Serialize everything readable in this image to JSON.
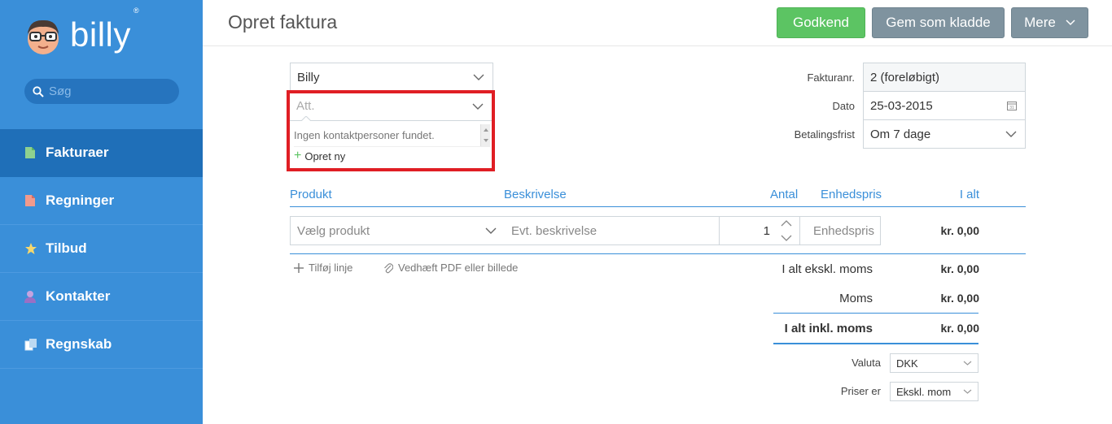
{
  "app": {
    "logo_text": "billy",
    "logo_reg": "®"
  },
  "search": {
    "placeholder": "Søg"
  },
  "nav": {
    "items": [
      {
        "label": "Fakturaer",
        "icon": "invoice-icon",
        "active": true
      },
      {
        "label": "Regninger",
        "icon": "bill-icon"
      },
      {
        "label": "Tilbud",
        "icon": "star-icon"
      },
      {
        "label": "Kontakter",
        "icon": "person-icon"
      },
      {
        "label": "Regnskab",
        "icon": "ledger-icon"
      }
    ]
  },
  "header": {
    "title": "Opret faktura",
    "approve_label": "Godkend",
    "draft_label": "Gem som kladde",
    "more_label": "Mere"
  },
  "form": {
    "customer_value": "Billy",
    "att_placeholder": "Att.",
    "att_dropdown": {
      "empty_message": "Ingen kontaktpersoner fundet.",
      "create_label": "Opret ny"
    },
    "invoice_no_label": "Fakturanr.",
    "invoice_no_value": "2 (foreløbigt)",
    "date_label": "Dato",
    "date_value": "25-03-2015",
    "due_label": "Betalingsfrist",
    "due_value": "Om 7 dage"
  },
  "lines": {
    "columns": {
      "product": "Produkt",
      "description": "Beskrivelse",
      "quantity": "Antal",
      "unit_price": "Enhedspris",
      "total": "I alt"
    },
    "row": {
      "product_placeholder": "Vælg produkt",
      "description_placeholder": "Evt. beskrivelse",
      "quantity": "1",
      "unit_price_placeholder": "Enhedspris",
      "total": "kr. 0,00"
    },
    "add_line_label": "Tilføj linje",
    "attach_label": "Vedhæft PDF eller billede"
  },
  "totals": {
    "excl_label": "I alt ekskl. moms",
    "excl_value": "kr. 0,00",
    "vat_label": "Moms",
    "vat_value": "kr. 0,00",
    "incl_label": "I alt inkl. moms",
    "incl_value": "kr. 0,00"
  },
  "settings": {
    "currency_label": "Valuta",
    "currency_value": "DKK",
    "prices_label": "Priser er",
    "prices_value": "Ekskl. mom"
  },
  "colors": {
    "sidebar": "#3a8fd9",
    "sidebar_active": "#1f6fb8",
    "approve": "#5cc463",
    "secondary": "#7f939f",
    "highlight": "#e01e24",
    "accent": "#3a8fd9"
  }
}
